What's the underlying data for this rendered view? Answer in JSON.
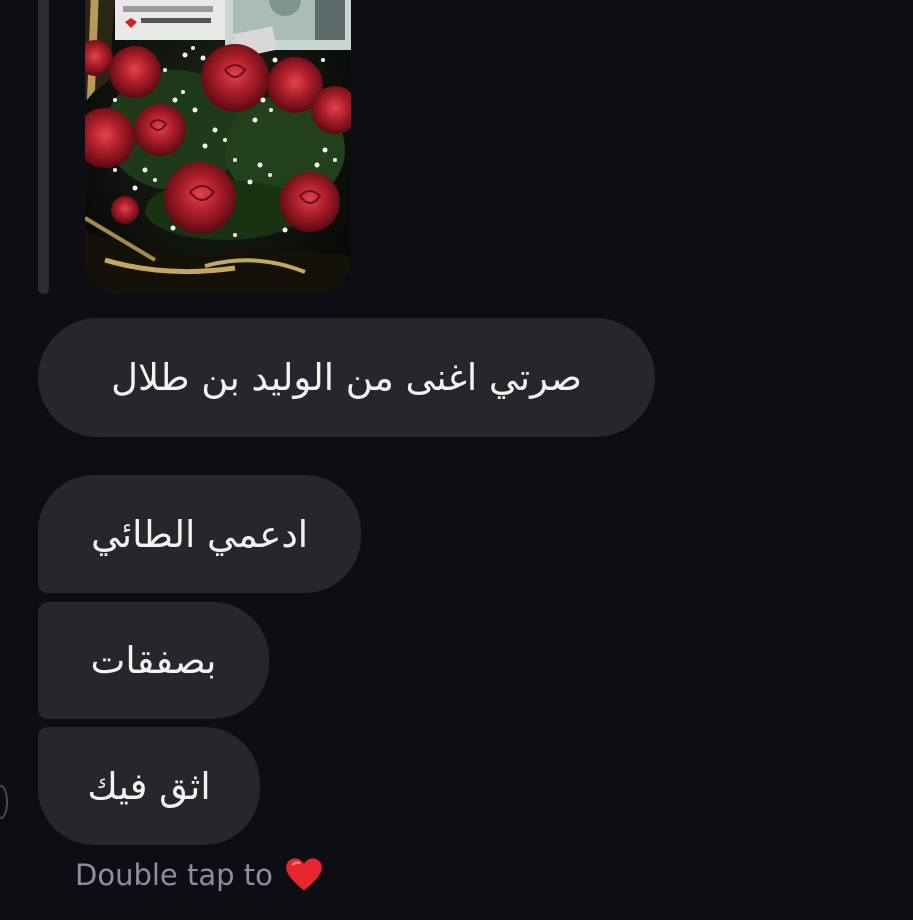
{
  "conversation": {
    "messages": [
      "صرتي اغنى من الوليد بن طلال",
      "ادعمي الطائي",
      "بصفقات",
      "اثق فيك"
    ],
    "hint": "Double tap to",
    "reaction_icon": "heart-icon",
    "colors": {
      "background": "#0c0e13",
      "bubble": "#25272c",
      "text": "#f3f3f3",
      "hint_text": "#8d9097",
      "heart": "#e8242f"
    }
  }
}
